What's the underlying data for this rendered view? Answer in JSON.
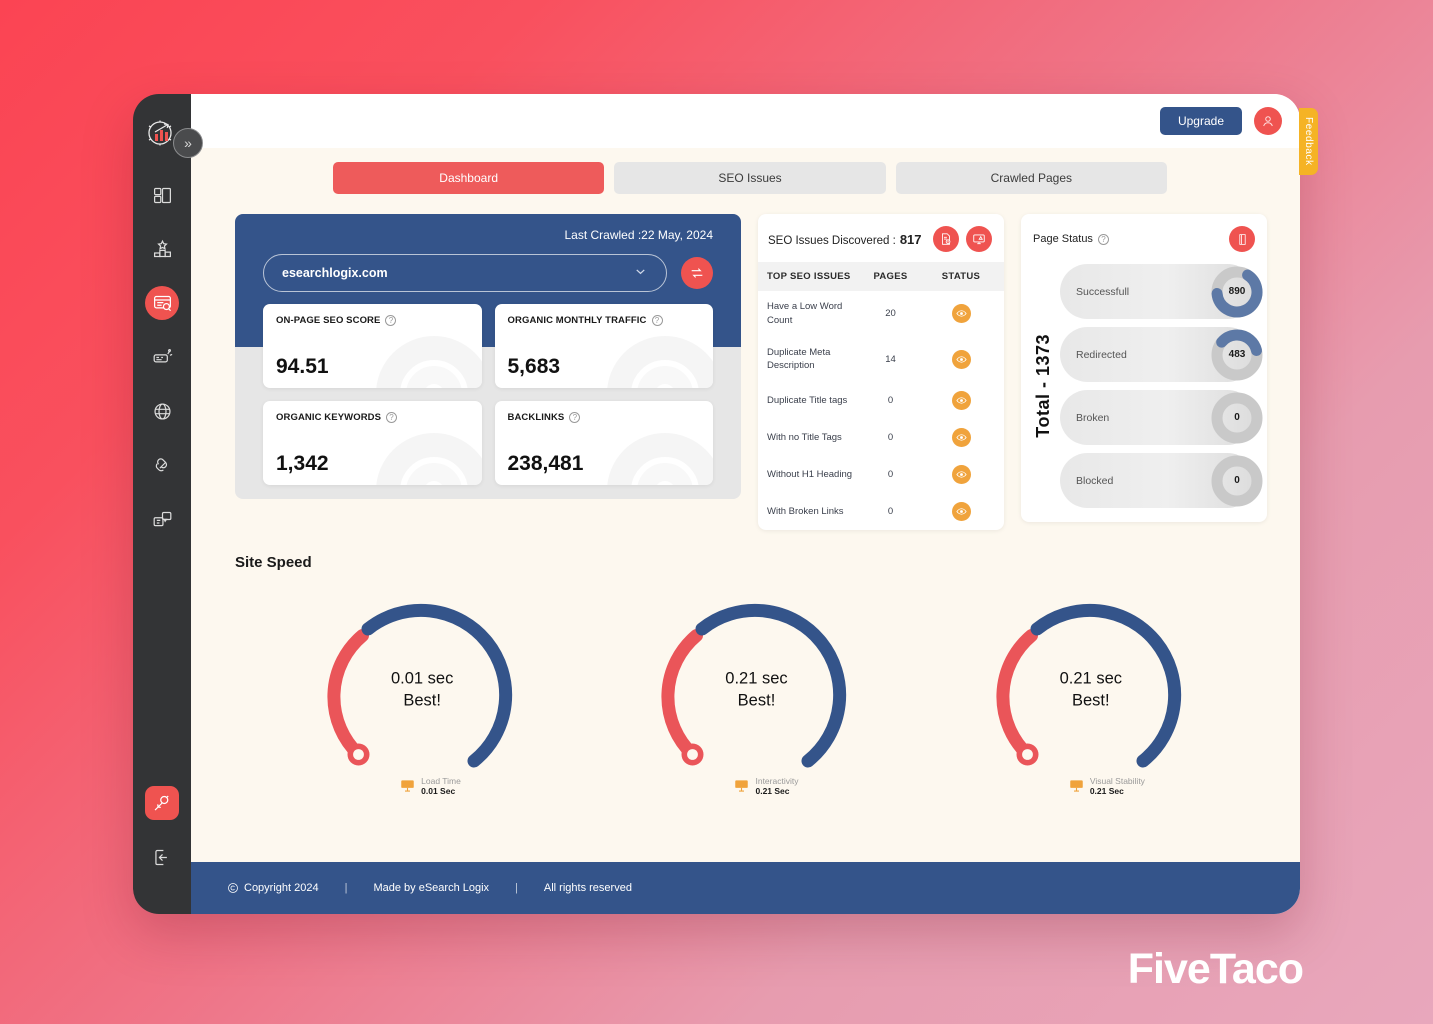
{
  "brand": {
    "watermark": "FiveTaco"
  },
  "sidebar": {
    "logo_name": "analytics-gear-logo",
    "collapse_label": "»",
    "items": [
      {
        "name": "dashboard-layout",
        "label": "Dashboard"
      },
      {
        "name": "rank-tracker",
        "label": "Rank Tracker"
      },
      {
        "name": "site-audit",
        "label": "Site Audit",
        "active": true
      },
      {
        "name": "keyword-research",
        "label": "Keyword Research"
      },
      {
        "name": "backlinks",
        "label": "Backlinks"
      },
      {
        "name": "link-tools",
        "label": "Link Tools"
      },
      {
        "name": "reports-chat",
        "label": "Reports"
      },
      {
        "name": "settings-tools",
        "label": "Tools",
        "active": true
      },
      {
        "name": "logout",
        "label": "Logout"
      }
    ]
  },
  "topbar": {
    "upgrade_label": "Upgrade",
    "avatar_name": "user-avatar",
    "feedback_label": "Feedback"
  },
  "tabs": [
    {
      "label": "Dashboard",
      "active": true
    },
    {
      "label": "SEO Issues",
      "active": false
    },
    {
      "label": "Crawled Pages",
      "active": false
    }
  ],
  "overview": {
    "last_crawled": "Last Crawled :22 May, 2024",
    "selected_site": "esearchlogix.com",
    "swap_icon": "swap-icon",
    "metrics": [
      {
        "label": "ON-PAGE SEO SCORE",
        "value": "94.51"
      },
      {
        "label": "ORGANIC MONTHLY TRAFFIC",
        "value": "5,683"
      },
      {
        "label": "ORGANIC KEYWORDS",
        "value": "1,342"
      },
      {
        "label": "BACKLINKS",
        "value": "238,481"
      }
    ]
  },
  "seo_issues": {
    "title": "SEO Issues Discovered :",
    "count": "817",
    "head_icons": [
      "report-download-icon",
      "monitor-alert-icon"
    ],
    "columns": [
      "TOP SEO ISSUES",
      "PAGES",
      "STATUS"
    ],
    "rows": [
      {
        "issue": "Have a Low Word Count",
        "pages": "20",
        "status_icon": "eye-icon"
      },
      {
        "issue": "Duplicate Meta Description",
        "pages": "14",
        "status_icon": "eye-icon"
      },
      {
        "issue": "Duplicate Title tags",
        "pages": "0",
        "status_icon": "eye-icon"
      },
      {
        "issue": "With no Title Tags",
        "pages": "0",
        "status_icon": "eye-icon"
      },
      {
        "issue": "Without H1 Heading",
        "pages": "0",
        "status_icon": "eye-icon"
      },
      {
        "issue": "With Broken Links",
        "pages": "0",
        "status_icon": "eye-icon"
      }
    ]
  },
  "page_status": {
    "title": "Page Status",
    "book_icon": "book-icon",
    "total_label": "Total - 1373",
    "total": 1373,
    "rows": [
      {
        "label": "Successfull",
        "value": "890",
        "pct": 64.8
      },
      {
        "label": "Redirected",
        "value": "483",
        "pct": 35.2
      },
      {
        "label": "Broken",
        "value": "0",
        "pct": 0
      },
      {
        "label": "Blocked",
        "value": "0",
        "pct": 0
      }
    ]
  },
  "site_speed": {
    "title": "Site Speed",
    "gauges": [
      {
        "value": "0.01 sec",
        "rating": "Best!",
        "legend_label": "Load Time",
        "legend_value": "0.01 Sec"
      },
      {
        "value": "0.21 sec",
        "rating": "Best!",
        "legend_label": "Interactivity",
        "legend_value": "0.21 Sec"
      },
      {
        "value": "0.21 sec",
        "rating": "Best!",
        "legend_label": "Visual Stability",
        "legend_value": "0.21 Sec"
      }
    ]
  },
  "footer": {
    "copyright": "Copyright 2024",
    "made_by": "Made by eSearch Logix",
    "rights": "All rights reserved",
    "sep": "|"
  },
  "colors": {
    "accent_red": "#ef5350",
    "deep_blue": "#34548a",
    "amber": "#f0a33c",
    "feedback_yellow": "#f5b325",
    "sidebar_dark": "#333436",
    "canvas_cream": "#fdf8ef"
  },
  "chart_data": [
    {
      "type": "pie",
      "title": "Page Status",
      "categories": [
        "Successfull",
        "Redirected",
        "Broken",
        "Blocked"
      ],
      "values": [
        890,
        483,
        0,
        0
      ],
      "total": 1373,
      "legend": "inline-labels"
    },
    {
      "type": "bar",
      "title": "Top SEO Issues",
      "categories": [
        "Have a Low Word Count",
        "Duplicate Meta Description",
        "Duplicate Title tags",
        "With no Title Tags",
        "Without H1 Heading",
        "With Broken Links"
      ],
      "values": [
        20,
        14,
        0,
        0,
        0,
        0
      ],
      "xlabel": "PAGES",
      "ylabel": ""
    },
    {
      "type": "bar",
      "title": "Site Speed",
      "categories": [
        "Load Time",
        "Interactivity",
        "Visual Stability"
      ],
      "values": [
        0.01,
        0.21,
        0.21
      ],
      "ylabel": "Seconds"
    }
  ]
}
